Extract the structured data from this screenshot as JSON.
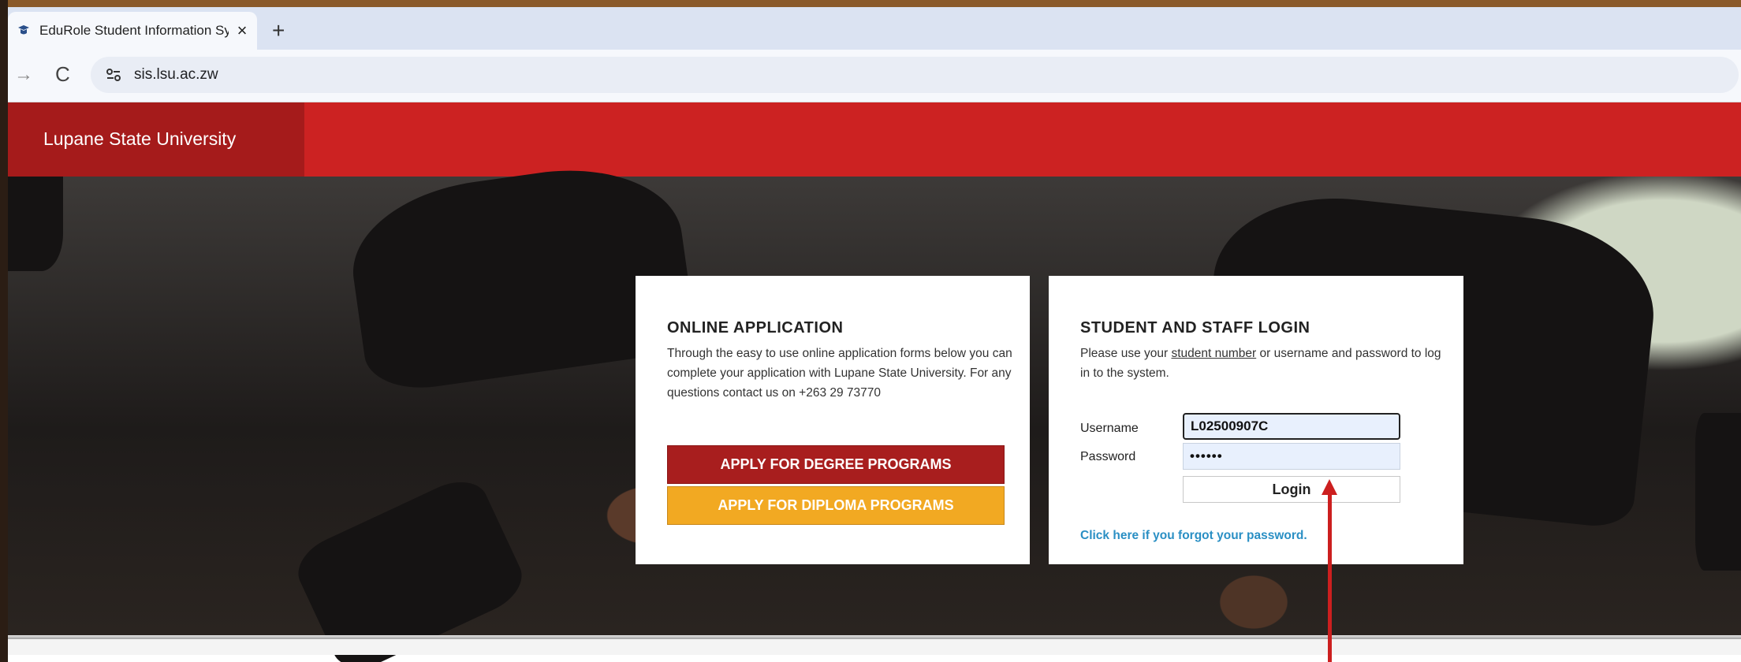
{
  "browser": {
    "tab_title": "EduRole Student Information Sy",
    "tab_close": "×",
    "new_tab": "+",
    "url": "sis.lsu.ac.zw",
    "forward_icon": "→",
    "reload_icon": "C"
  },
  "header": {
    "brand": "Lupane State University"
  },
  "apply": {
    "title": "ONLINE APPLICATION",
    "description": "Through the easy to use online application forms below you can complete your application with Lupane State University. For any questions contact us on +263 29 73770",
    "degree_button": "APPLY FOR DEGREE PROGRAMS",
    "diploma_button": "APPLY FOR DIPLOMA PROGRAMS"
  },
  "login": {
    "title": "STUDENT AND STAFF LOGIN",
    "desc_pre": "Please use your ",
    "desc_link": "student number",
    "desc_post": " or username and password to log in to the system.",
    "username_label": "Username",
    "username_value": "L02500907C",
    "password_label": "Password",
    "password_value": "••••••",
    "login_button": "Login",
    "forgot_link": "Click here if you forgot your password."
  },
  "colors": {
    "header_red": "#cc2222",
    "brand_red": "#a51b1b",
    "degree_red": "#a81e1e",
    "diploma_orange": "#f2a922",
    "link_blue": "#2a8fc4",
    "annotation_red": "#cc1f1f"
  }
}
